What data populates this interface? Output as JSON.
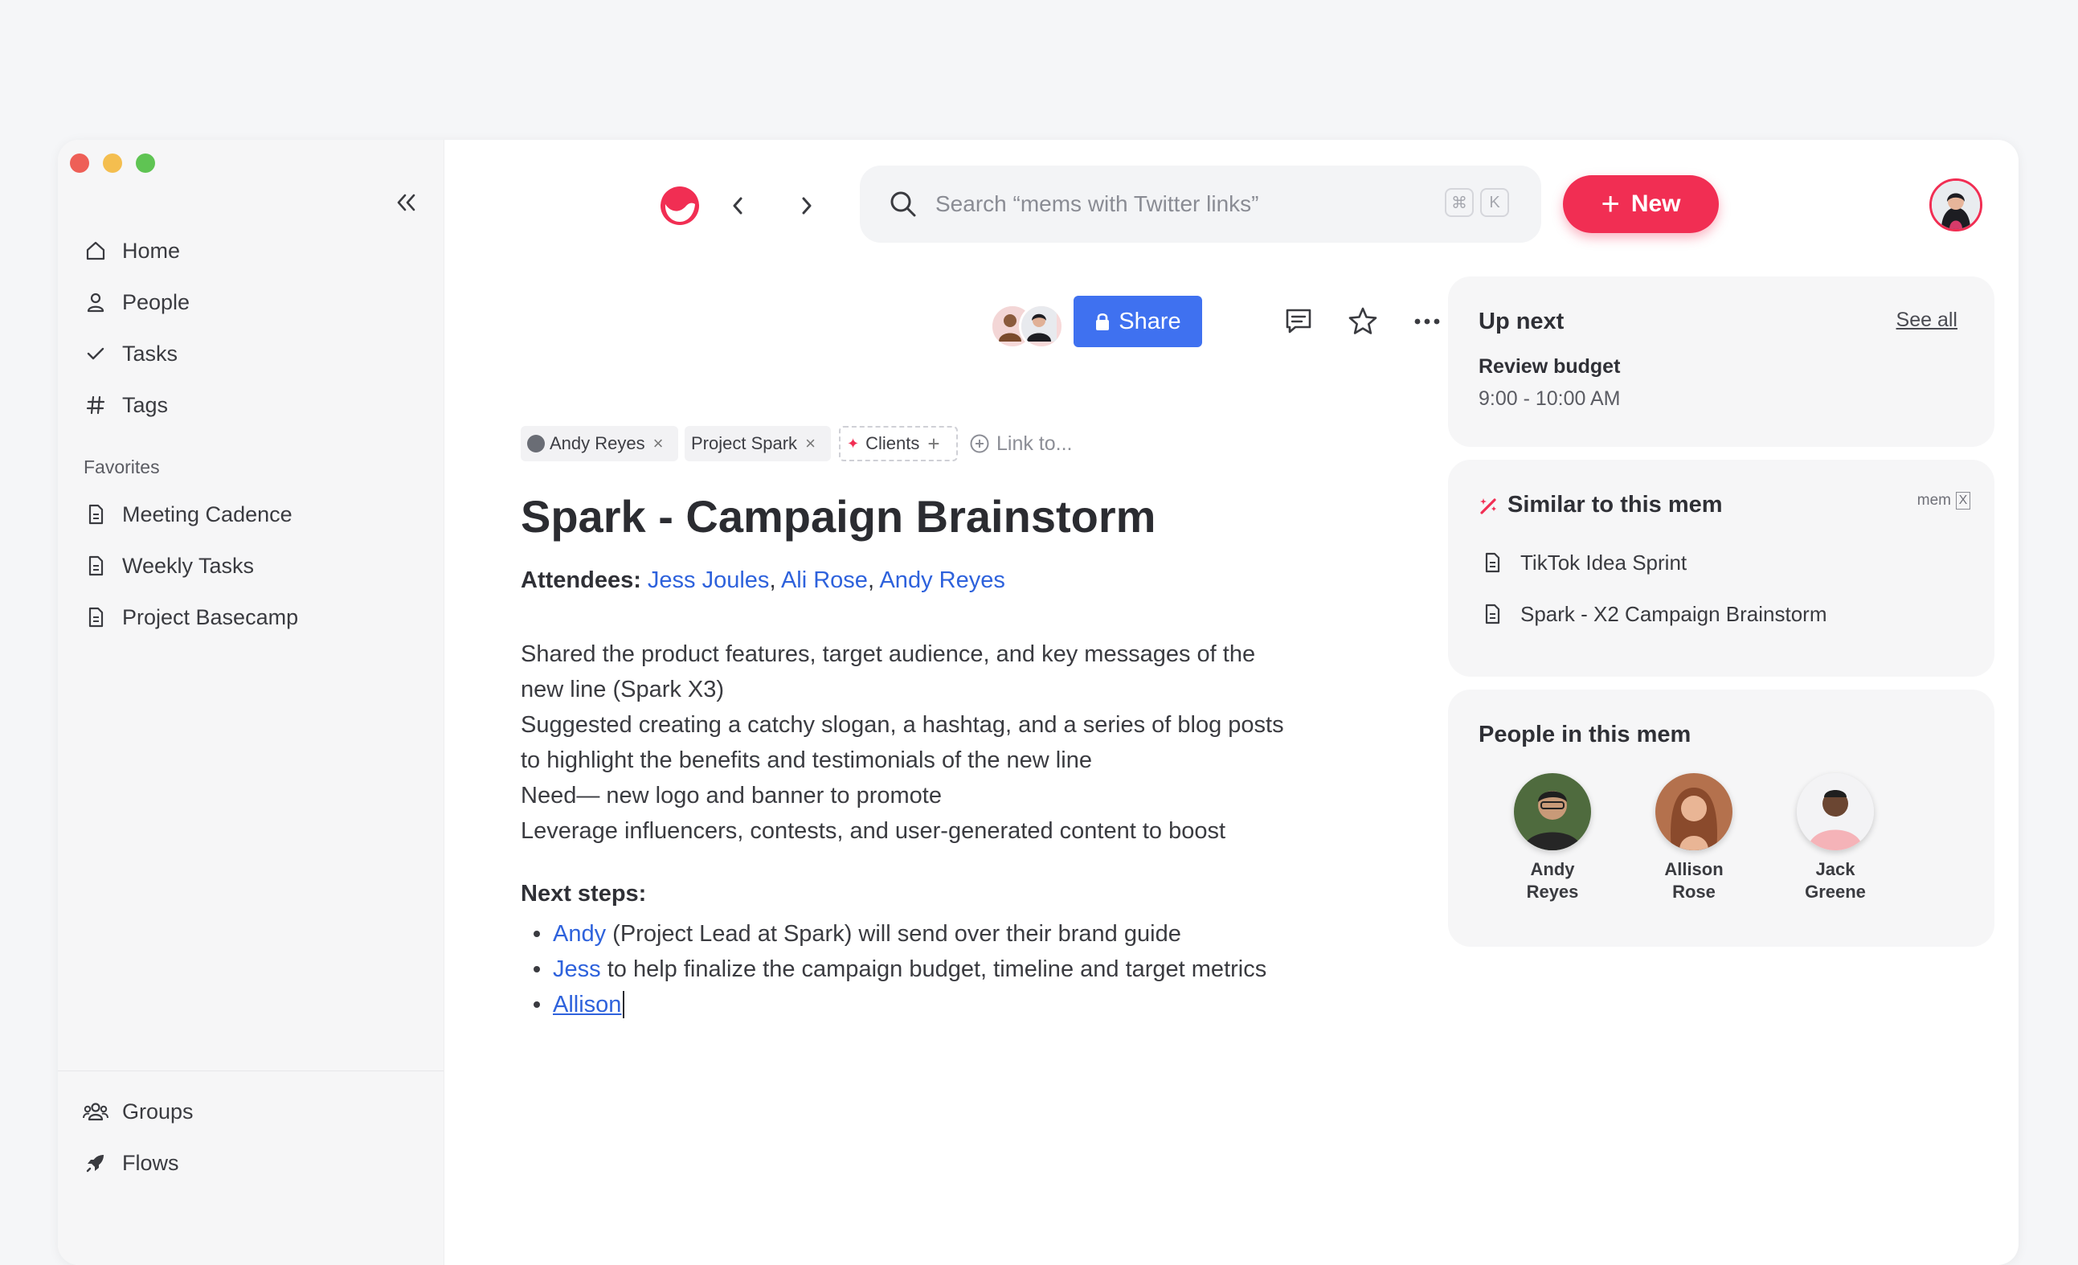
{
  "sidebar": {
    "nav": [
      {
        "label": "Home",
        "icon": "home-icon"
      },
      {
        "label": "People",
        "icon": "person-icon"
      },
      {
        "label": "Tasks",
        "icon": "check-icon"
      },
      {
        "label": "Tags",
        "icon": "hash-icon"
      }
    ],
    "favorites_label": "Favorites",
    "favorites": [
      {
        "label": "Meeting Cadence",
        "icon": "document-icon"
      },
      {
        "label": "Weekly Tasks",
        "icon": "document-icon"
      },
      {
        "label": "Project Basecamp",
        "icon": "document-icon"
      }
    ],
    "bottom": [
      {
        "label": "Groups",
        "icon": "groups-icon"
      },
      {
        "label": "Flows",
        "icon": "rocket-icon"
      }
    ]
  },
  "topbar": {
    "search_placeholder": "Search “mems with Twitter links”",
    "kbd_cmd": "⌘",
    "kbd_k": "K",
    "new_label": "New"
  },
  "toolbar": {
    "share_label": "Share"
  },
  "chips": {
    "person": "Andy Reyes",
    "project": "Project Spark",
    "clients": "Clients",
    "link_to": "Link to..."
  },
  "doc": {
    "title": "Spark - Campaign Brainstorm",
    "attendees_label": "Attendees:",
    "attendees": [
      "Jess Joules",
      "Ali Rose",
      "Andy Reyes"
    ],
    "paragraphs": [
      "Shared the product features, target audience, and key messages of the",
      "new line (Spark X3)",
      "Suggested creating a catchy slogan, a hashtag, and a series of blog posts",
      "to highlight the benefits and testimonials of the new line",
      "Need— new logo and banner to promote",
      "Leverage influencers, contests, and user-generated content to boost"
    ],
    "next_steps_label": "Next steps:",
    "steps": [
      {
        "mention": "Andy",
        "text": " (Project Lead at Spark) will send over their brand guide"
      },
      {
        "mention": "Jess",
        "text": " to help finalize the campaign budget, timeline and target metrics"
      },
      {
        "mention": "Allison",
        "text": ""
      }
    ]
  },
  "up_next": {
    "title": "Up next",
    "see_all": "See all",
    "event_title": "Review budget",
    "event_time": "9:00 - 10:00 AM"
  },
  "similar": {
    "title": "Similar to this mem",
    "badge": "mem",
    "badge_key": "X",
    "items": [
      "TikTok Idea Sprint",
      "Spark - X2 Campaign Brainstorm"
    ]
  },
  "people": {
    "title": "People in this mem",
    "list": [
      {
        "first": "Andy",
        "last": "Reyes"
      },
      {
        "first": "Allison",
        "last": "Rose"
      },
      {
        "first": "Jack",
        "last": "Greene"
      }
    ]
  },
  "colors": {
    "accent_red": "#f12e53",
    "share_blue": "#3f71f0",
    "link_blue": "#2e62dc"
  }
}
